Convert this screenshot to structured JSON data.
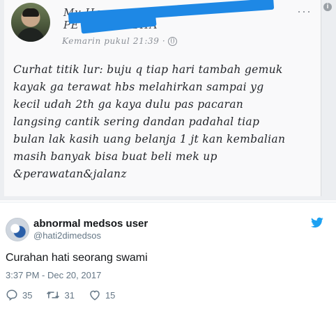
{
  "facebook_post": {
    "author_name": "Mu Ha",
    "page_name": "PE ALANG RAYA",
    "timestamp": "Kemarin pukul 21:39 ·",
    "body_lines": [
      "Curhat titik lur: buju q tiap hari tambah gemuk",
      "kayak ga terawat hbs melahirkan sampai yg",
      "kecil udah 2th ga kaya dulu pas pacaran",
      "langsing cantik sering dandan padahal tiap",
      "bulan lak kasih uang belanja 1 jt kan kembalian",
      "masih banyak bisa buat beli mek up",
      "&perawatan&jalanz"
    ],
    "more_glyph": "···"
  },
  "tweet": {
    "display_name": "abnormal medsos user",
    "handle": "@hati2dimedsos",
    "text": "Curahan hati seorang swami",
    "timestamp": "3:37 PM - Dec 20, 2017",
    "replies": "35",
    "retweets": "31",
    "likes": "15"
  },
  "colors": {
    "twitter_blue": "#1da1f2",
    "redaction_blue": "#1e88e5",
    "secondary_text": "#657786"
  },
  "icons": {
    "info": "info-icon",
    "globe": "globe-icon",
    "bird": "twitter-bird-icon",
    "reply": "reply-icon",
    "retweet": "retweet-icon",
    "like": "heart-icon"
  }
}
